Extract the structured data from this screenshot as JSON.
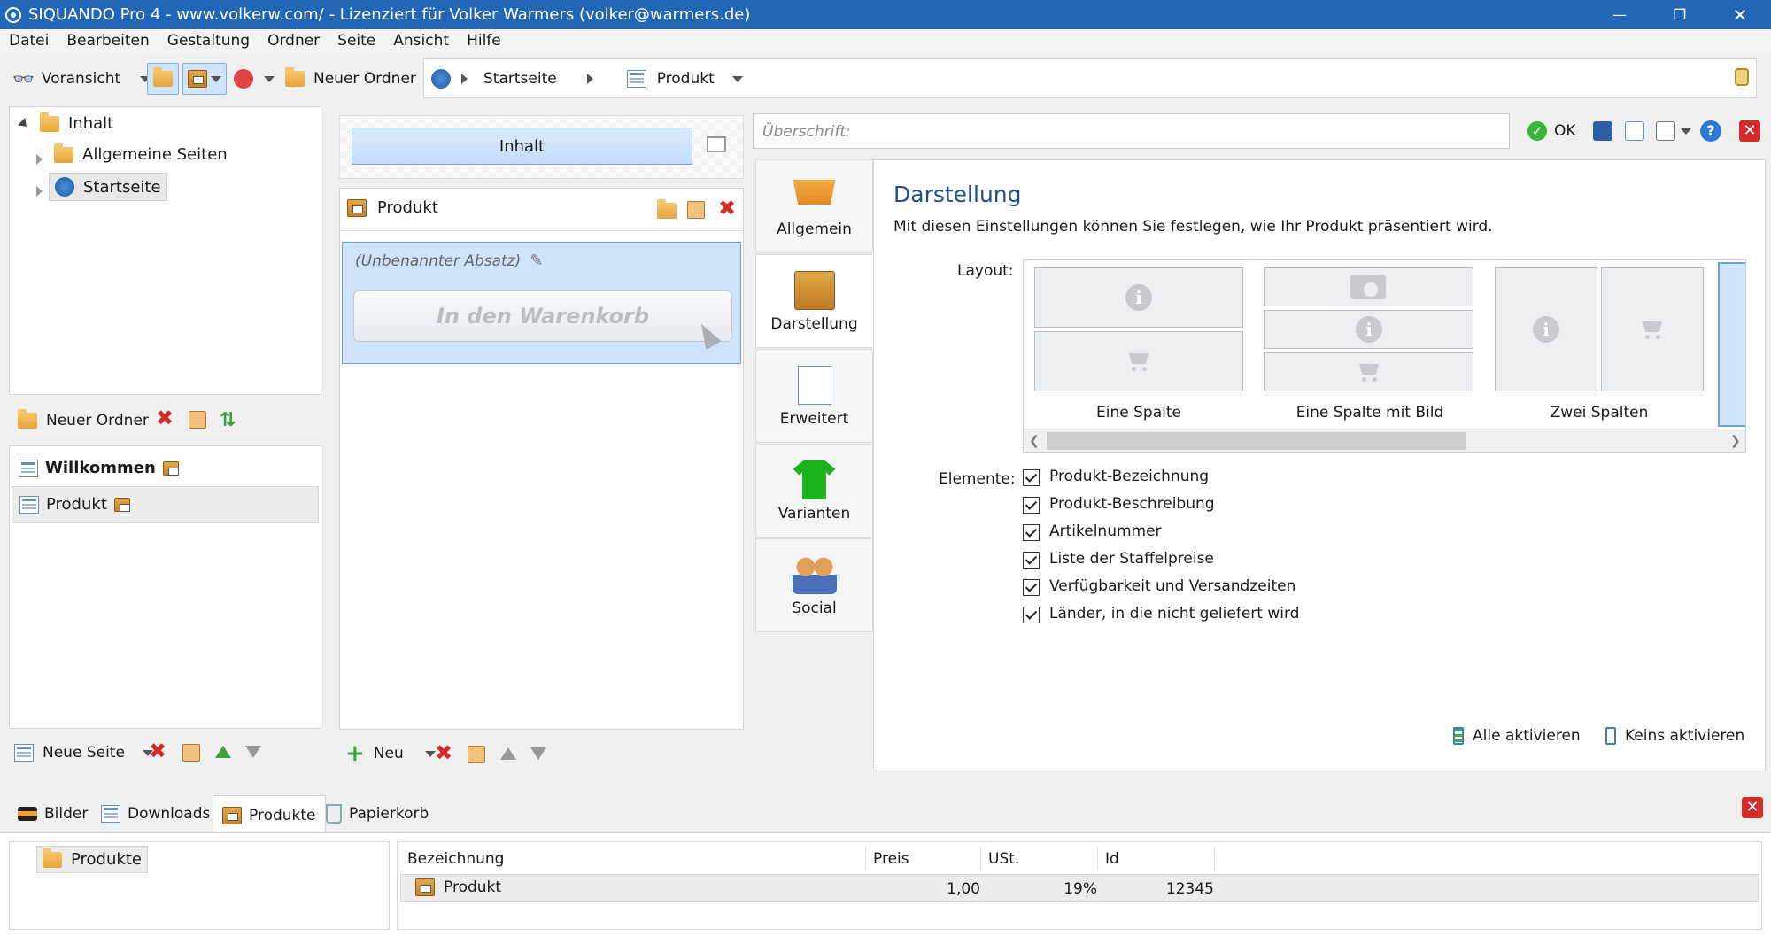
{
  "window": {
    "title": "SIQUANDO Pro 4 - www.volkerw.com/ - Lizenziert für Volker Warmers (volker@warmers.de)"
  },
  "menu": [
    "Datei",
    "Bearbeiten",
    "Gestaltung",
    "Ordner",
    "Seite",
    "Ansicht",
    "Hilfe"
  ],
  "toolbar": {
    "preview": "Voransicht",
    "new_folder": "Neuer Ordner"
  },
  "breadcrumb": {
    "items": [
      "Startseite",
      "Produkt"
    ]
  },
  "tree": {
    "root": "Inhalt",
    "children": [
      "Allgemeine Seiten",
      "Startseite"
    ]
  },
  "folder_actions": {
    "new_folder": "Neuer Ordner"
  },
  "pages": {
    "items": [
      "Willkommen",
      "Produkt"
    ]
  },
  "page_actions": {
    "new_page": "Neue Seite"
  },
  "content": {
    "tab": "Inhalt",
    "block_title": "Produkt",
    "paragraph": "(Unbenannter Absatz)",
    "button": "In den Warenkorb",
    "new": "Neu"
  },
  "editor": {
    "heading_placeholder": "Überschrift:",
    "ok": "OK"
  },
  "side_tabs": [
    "Allgemein",
    "Darstellung",
    "Erweitert",
    "Varianten",
    "Social"
  ],
  "settings": {
    "title": "Darstellung",
    "description": "Mit diesen Einstellungen können Sie festlegen, wie Ihr Produkt präsentiert wird.",
    "layout_label": "Layout:",
    "layouts": [
      "Eine Spalte",
      "Eine Spalte mit Bild",
      "Zwei Spalten"
    ],
    "elements_label": "Elemente:",
    "elements": [
      {
        "label": "Produkt-Bezeichnung",
        "checked": true
      },
      {
        "label": "Produkt-Beschreibung",
        "checked": true
      },
      {
        "label": "Artikelnummer",
        "checked": true
      },
      {
        "label": "Liste der Staffelpreise",
        "checked": true
      },
      {
        "label": "Verfügbarkeit und Versandzeiten",
        "checked": true
      },
      {
        "label": "Länder, in die nicht geliefert wird",
        "checked": true
      }
    ],
    "activate_all": "Alle aktivieren",
    "deactivate_all": "Keins aktivieren"
  },
  "bottom_tabs": [
    "Bilder",
    "Downloads",
    "Produkte",
    "Papierkorb"
  ],
  "products": {
    "folder": "Produkte",
    "columns": [
      "Bezeichnung",
      "Preis",
      "USt.",
      "Id"
    ],
    "rows": [
      {
        "name": "Produkt",
        "price": "1,00",
        "vat": "19%",
        "id": "12345"
      }
    ]
  },
  "colors": {
    "titlebar": "#2266b8",
    "selection": "#cfe4fb",
    "accent_text": "#1f4e8c"
  }
}
